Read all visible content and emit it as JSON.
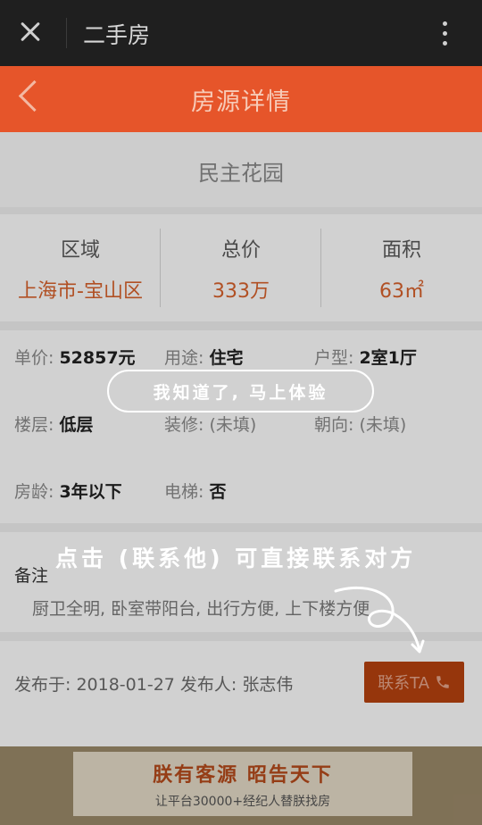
{
  "topbar": {
    "title": "二手房"
  },
  "header": {
    "title": "房源详情"
  },
  "listing": {
    "community": "民主花园",
    "stats": [
      {
        "label": "区域",
        "value": "上海市-宝山区"
      },
      {
        "label": "总价",
        "value": "333万"
      },
      {
        "label": "面积",
        "value": "63㎡"
      }
    ],
    "details": {
      "unit_price_label": "单价:",
      "unit_price": "52857元",
      "usage_label": "用途:",
      "usage": "住宅",
      "layout_label": "户型:",
      "layout": "2室1厅",
      "floor_label": "楼层:",
      "floor": "低层",
      "decoration_label": "装修:",
      "decoration": "(未填)",
      "orientation_label": "朝向:",
      "orientation": "(未填)",
      "age_label": "房龄:",
      "age": "3年以下",
      "elevator_label": "电梯:",
      "elevator": "否"
    },
    "remark_title": "备注",
    "remark_text": "厨卫全明, 卧室带阳台, 出行方便, 上下楼方便",
    "publish_label": "发布于:",
    "publish_date": "2018-01-27",
    "publisher_label": "发布人:",
    "publisher_name": "张志伟",
    "contact_button": "联系TA"
  },
  "banner": {
    "main": "朕有客源 昭告天下",
    "sub": "让平台30000+经纪人替朕找房"
  },
  "guide": {
    "acknowledge": "我知道了, 马上体验",
    "tip": "点击 (联系他) 可直接联系对方"
  },
  "colors": {
    "accent": "#e6552a",
    "price": "#d8622c",
    "button": "#b8420f"
  },
  "icons": [
    "close-icon",
    "more-vertical-icon",
    "back-chevron-icon",
    "phone-icon",
    "arrow-curve-icon"
  ]
}
